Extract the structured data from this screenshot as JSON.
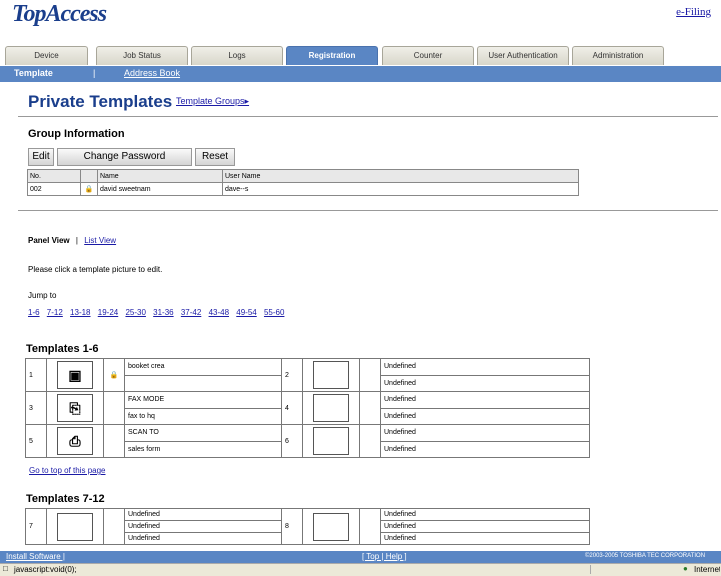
{
  "header": {
    "logo": "TopAccess",
    "efiling": "e-Filing"
  },
  "tabs": [
    "Device",
    "Job Status",
    "Logs",
    "Registration",
    "Counter",
    "User Authentication",
    "Administration"
  ],
  "subnav": {
    "template": "Template",
    "separator": "|",
    "address_book": "Address Book"
  },
  "page": {
    "title": "Private Templates",
    "template_groups": "Template Groups▸"
  },
  "group": {
    "heading": "Group Information",
    "buttons": {
      "edit": "Edit",
      "change_password": "Change Password",
      "reset": "Reset"
    },
    "columns": [
      "No.",
      "Name",
      "User Name"
    ],
    "row": {
      "no": "002",
      "name": "david sweetnam",
      "user_name": "dave--s"
    }
  },
  "view": {
    "panel": "Panel View",
    "sep": "|",
    "list": "List View"
  },
  "instructions": "Please click a template picture to edit.",
  "jump_to": "Jump to",
  "jump_links": [
    "1-6",
    "7-12",
    "13-18",
    "19-24",
    "25-30",
    "31-36",
    "37-42",
    "43-48",
    "49-54",
    "55-60"
  ],
  "templates_1_6": {
    "heading": "Templates 1-6",
    "rows": [
      {
        "left_no": "1",
        "left_icon": "▣",
        "left_lock": true,
        "left_a": "booket crea",
        "left_b": "",
        "right_no": "2",
        "right_a": "Undefined",
        "right_b": "Undefined"
      },
      {
        "left_no": "3",
        "left_icon": "⎘",
        "left_lock": false,
        "left_a": "FAX MODE",
        "left_b": "fax to hq",
        "right_no": "4",
        "right_a": "Undefined",
        "right_b": "Undefined"
      },
      {
        "left_no": "5",
        "left_icon": "⎙",
        "left_lock": false,
        "left_a": "SCAN TO",
        "left_b": "sales form",
        "right_no": "6",
        "right_a": "Undefined",
        "right_b": "Undefined"
      }
    ]
  },
  "goto_top": "Go to top of this page",
  "templates_7_12": {
    "heading": "Templates 7-12",
    "rows": [
      {
        "left_no": "7",
        "left_a": "Undefined",
        "left_b": "Undefined",
        "left_c": "Undefined",
        "right_no": "8",
        "right_a": "Undefined",
        "right_b": "Undefined",
        "right_c": "Undefined"
      }
    ]
  },
  "footer": {
    "install": "Install Software |",
    "top_help": "[ Top | Help ]",
    "copyright": "©2003-2005 TOSHIBA TEC CORPORATION"
  },
  "status": {
    "text": "javascript:void(0);",
    "zone": "Internet"
  }
}
